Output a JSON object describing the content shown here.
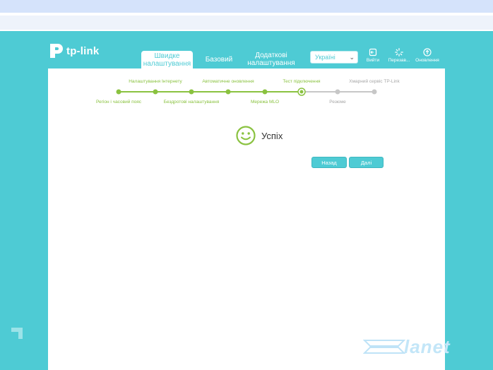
{
  "brand": {
    "logo_text": "tp-link"
  },
  "nav": {
    "tabs": [
      {
        "line1": "Швидке",
        "line2": "налаштування",
        "active": true
      },
      {
        "line1": "Базовий",
        "line2": "",
        "active": false
      },
      {
        "line1": "Додаткові",
        "line2": "налаштування",
        "active": false
      }
    ]
  },
  "language": {
    "selected": "Україні"
  },
  "actions": {
    "logout": "Вийти",
    "reboot": "Перезав...",
    "update": "Оновлення"
  },
  "wizard": {
    "steps_top": [
      {
        "label": "Налаштування Інтернету",
        "state": "done"
      },
      {
        "label": "Автоматичне оновлення",
        "state": "done"
      },
      {
        "label": "Тест підключення",
        "state": "done"
      },
      {
        "label": "Хмарний сервіс TP-Link",
        "state": "todo"
      }
    ],
    "steps_bottom": [
      {
        "label": "Регіон і часовий пояс",
        "state": "done"
      },
      {
        "label": "Бездротові налаштування",
        "state": "done"
      },
      {
        "label": "Мережа MLO",
        "state": "done"
      },
      {
        "label": "Резюме",
        "state": "todo"
      }
    ],
    "current_step": 6,
    "total_nodes": 8
  },
  "result": {
    "message": "Успіх"
  },
  "buttons": {
    "back": "Назад",
    "next": "Далі"
  },
  "watermark": {
    "text": "lanet"
  },
  "colors": {
    "accent": "#4ecbd4",
    "done": "#8ac240",
    "todo": "#c7c7c7"
  }
}
